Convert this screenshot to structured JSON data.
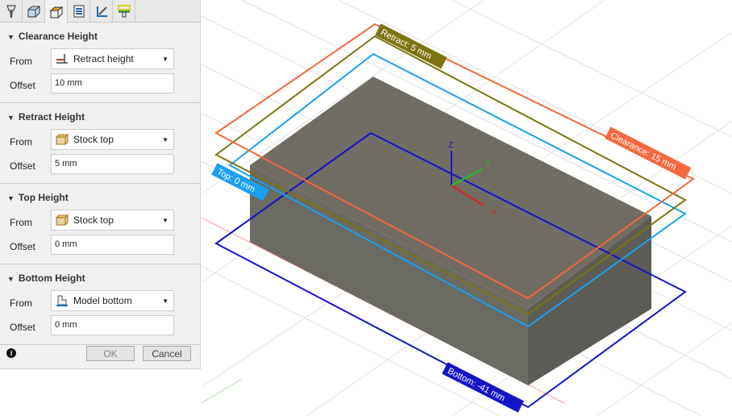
{
  "tabs": [
    {
      "name": "tool-tab"
    },
    {
      "name": "geometry-tab"
    },
    {
      "name": "heights-tab"
    },
    {
      "name": "passes-tab"
    },
    {
      "name": "linking-tab"
    },
    {
      "name": "shaft-holder-tab"
    }
  ],
  "sections": [
    {
      "title": "Clearance Height",
      "from_label": "From",
      "from_value": "Retract height",
      "offset_label": "Offset",
      "offset_value": "10 mm"
    },
    {
      "title": "Retract Height",
      "from_label": "From",
      "from_value": "Stock top",
      "offset_label": "Offset",
      "offset_value": "5 mm"
    },
    {
      "title": "Top Height",
      "from_label": "From",
      "from_value": "Stock top",
      "offset_label": "Offset",
      "offset_value": "0 mm"
    },
    {
      "title": "Bottom Height",
      "from_label": "From",
      "from_value": "Model bottom",
      "offset_label": "Offset",
      "offset_value": "0 mm"
    }
  ],
  "footer": {
    "ok": "OK",
    "cancel": "Cancel"
  },
  "viewport": {
    "labels": {
      "clearance": "Clearance: 15 mm",
      "retract": "Retract: 5 mm",
      "top": "Top: 0 mm",
      "bottom": "Bottom: -41 mm"
    },
    "axes": {
      "x": "X",
      "y": "Y",
      "z": "Z"
    },
    "colors": {
      "clearance": "#f4683c",
      "retract": "#7b7410",
      "top": "#1aa0f0",
      "bottom": "#1414c8"
    }
  }
}
